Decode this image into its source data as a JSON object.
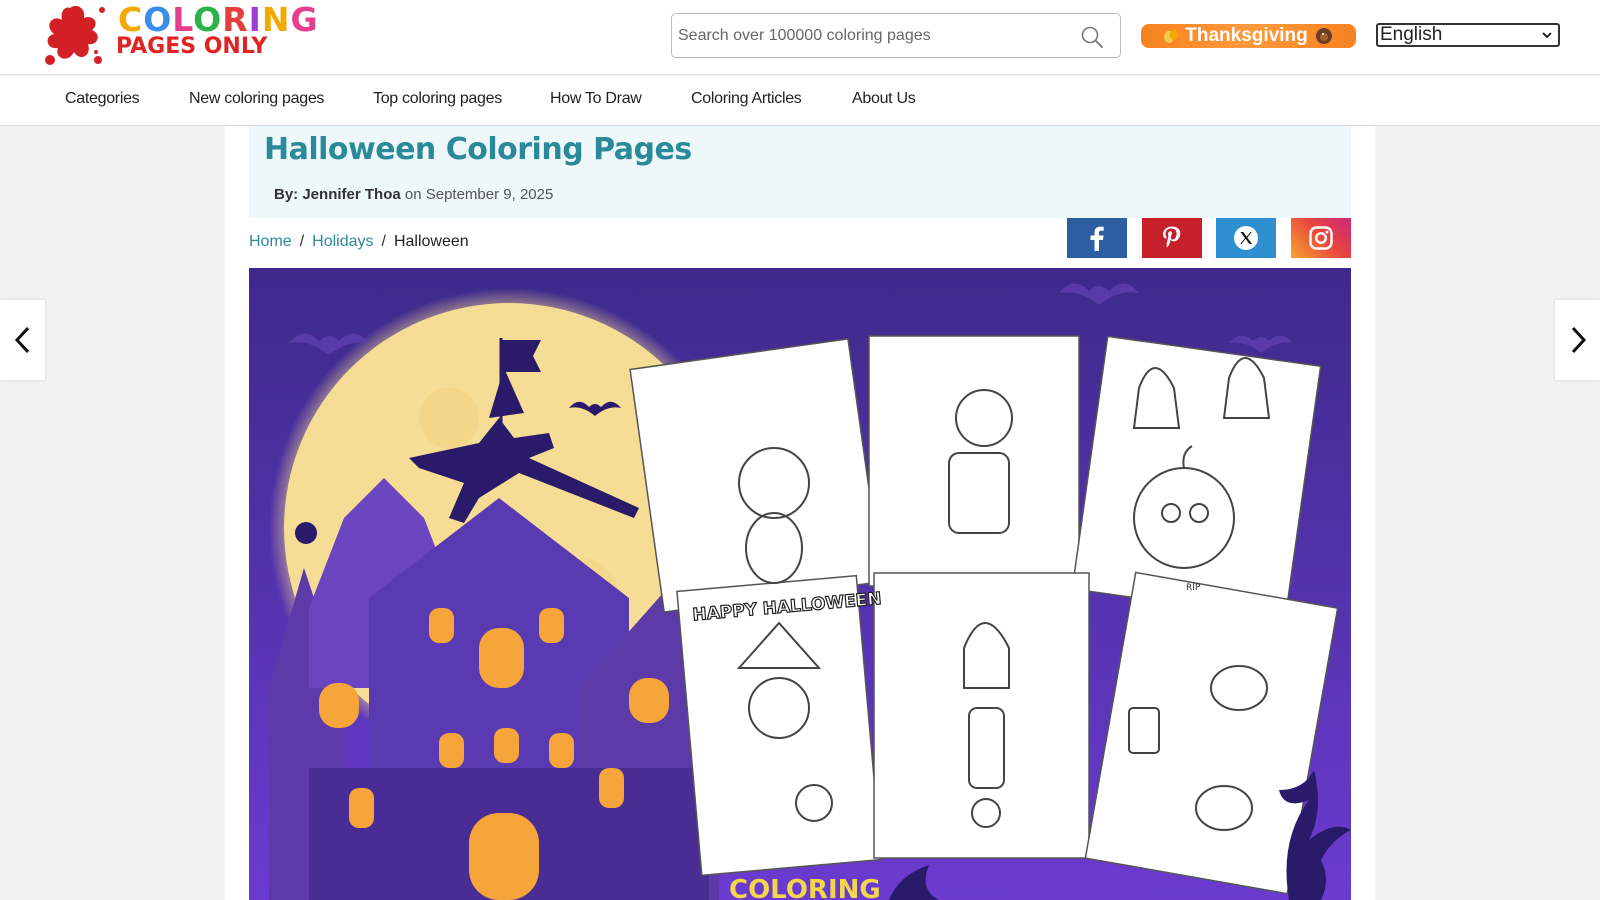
{
  "header": {
    "logo": {
      "line1": "COLORING",
      "line2": "PAGES ONLY"
    },
    "search": {
      "placeholder": "Search over 100000 coloring pages"
    },
    "season_button": {
      "label": "Thanksgiving"
    },
    "language": {
      "selected": "English"
    }
  },
  "nav": {
    "items": [
      {
        "label": "Categories"
      },
      {
        "label": "New coloring pages"
      },
      {
        "label": "Top coloring pages"
      },
      {
        "label": "How To Draw"
      },
      {
        "label": "Coloring Articles"
      },
      {
        "label": "About Us"
      }
    ]
  },
  "article": {
    "title": "Halloween Coloring Pages",
    "byline_prefix": "By:",
    "author": "Jennifer Thoa",
    "date_prefix": "on",
    "date": "September 9, 2025"
  },
  "breadcrumb": {
    "items": [
      "Home",
      "Holidays",
      "Halloween"
    ],
    "separator": "/"
  },
  "social": [
    {
      "name": "facebook",
      "color": "#2d5ea1"
    },
    {
      "name": "pinterest",
      "color": "#c8202a"
    },
    {
      "name": "x",
      "color": "#2e8fd1"
    },
    {
      "name": "instagram",
      "color": "#e8443d"
    }
  ],
  "hero": {
    "caption_cards": [
      "HAPPY HALLOWEEN",
      "RIP"
    ],
    "footer_logo": "COLORING"
  },
  "colors": {
    "accent_teal": "#2a8a99",
    "season_orange": "#f58220",
    "hero_purple": "#4a2a94"
  }
}
